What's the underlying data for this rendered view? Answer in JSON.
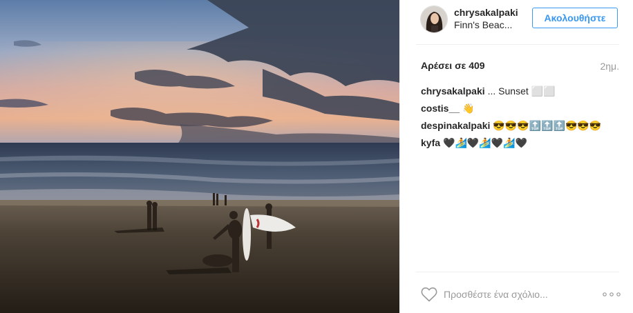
{
  "post": {
    "username": "chrysakalpaki",
    "location": "Finn's Beac...",
    "follow_label": "Ακολουθήστε",
    "likes": "Αρέσει σε 409",
    "timestamp": "2ημ.",
    "comments": [
      {
        "user": "chrysakalpaki",
        "text": "... Sunset ⬜⬜"
      },
      {
        "user": "costis__",
        "text": "👋"
      },
      {
        "user": "despinakalpaki",
        "text": "😎😎😎🔝🔝🔝😎😎😎"
      },
      {
        "user": "kyfa",
        "text": "🖤🏄🖤🏄🖤🏄🖤"
      }
    ],
    "comment_placeholder": "Προσθέστε ένα σχόλιο...",
    "icons": {
      "like": "heart-icon",
      "more": "more-options-icon",
      "avatar": "avatar"
    },
    "colors": {
      "accent": "#3897f0",
      "text": "#262626",
      "muted": "#999999",
      "divider": "#efefef"
    }
  }
}
